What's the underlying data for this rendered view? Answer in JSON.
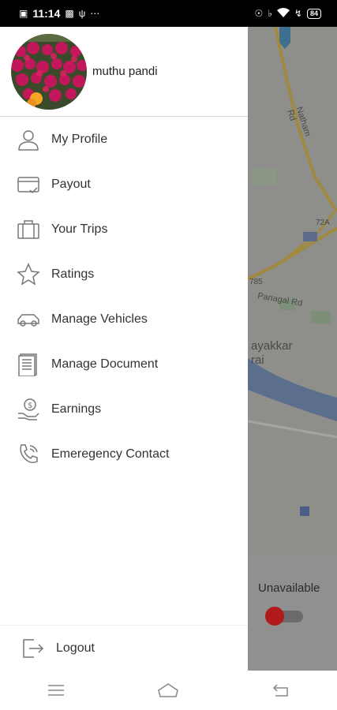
{
  "status_bar": {
    "time": "11:14",
    "left_icons": [
      "notification-icon",
      "app-icon",
      "usb-icon",
      "more-dots-icon"
    ],
    "right_icons": [
      "location-icon",
      "mute-icon",
      "wifi-icon",
      "charging-icon"
    ],
    "battery": "84"
  },
  "drawer": {
    "profile": {
      "name": "muthu pandi"
    },
    "menu": [
      {
        "label": "My Profile",
        "icon": "person-icon"
      },
      {
        "label": "Payout",
        "icon": "wallet-icon"
      },
      {
        "label": "Your Trips",
        "icon": "briefcase-icon"
      },
      {
        "label": "Ratings",
        "icon": "star-icon"
      },
      {
        "label": "Manage Vehicles",
        "icon": "car-icon"
      },
      {
        "label": "Manage Document",
        "icon": "document-icon"
      },
      {
        "label": "Earnings",
        "icon": "money-hand-icon"
      },
      {
        "label": "Emeregency Contact",
        "icon": "phone-icon"
      }
    ],
    "logout": {
      "label": "Logout",
      "icon": "logout-icon"
    }
  },
  "map": {
    "labels": [
      "Natham Rd",
      "72A",
      "785",
      "Panagal Rd",
      "ayakkar",
      "rai"
    ]
  },
  "availability": {
    "label": "Unavailable",
    "on": false,
    "knob_color": "#b11a1a"
  },
  "nav_bar": {
    "buttons": [
      "menu-icon",
      "home-icon",
      "back-icon"
    ]
  }
}
